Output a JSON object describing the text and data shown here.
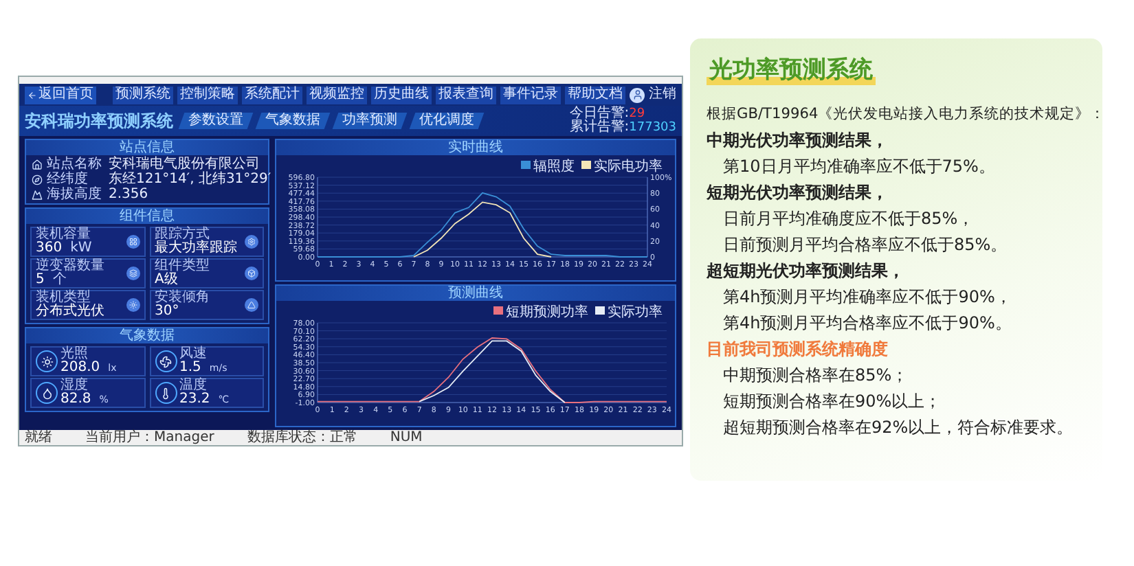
{
  "screenshot": {
    "nav": {
      "back": "返回首页",
      "items": [
        "预测系统",
        "控制策略",
        "系统配计",
        "视频监控",
        "历史曲线",
        "报表查询",
        "事件记录",
        "帮助文档"
      ],
      "user": "注销"
    },
    "header": {
      "title": "安科瑞功率预测系统",
      "tabs": [
        "参数设置",
        "气象数据",
        "功率预测",
        "优化调度"
      ],
      "alarms": [
        {
          "label": "今日告警:",
          "value": "29",
          "kind": "today"
        },
        {
          "label": "累计告警:",
          "value": "177303",
          "kind": "total"
        }
      ]
    },
    "site_panel": {
      "title": "站点信息",
      "rows": [
        {
          "label": "站点名称",
          "value": "安科瑞电气股份有限公司"
        },
        {
          "label": "经纬度",
          "value": "东经121°14′, 北纬31°29′"
        },
        {
          "label": "海拔高度",
          "value": "2.356"
        }
      ]
    },
    "component_panel": {
      "title": "组件信息",
      "cards": [
        {
          "label": "装机容量",
          "value": "360",
          "unit": "kW"
        },
        {
          "label": "跟踪方式",
          "value": "最大功率跟踪"
        },
        {
          "label": "逆变器数量",
          "value": "5",
          "unit": "个"
        },
        {
          "label": "组件类型",
          "value": "A级"
        },
        {
          "label": "装机类型",
          "value": "分布式光伏"
        },
        {
          "label": "安装倾角",
          "value": "30°"
        }
      ]
    },
    "weather_panel": {
      "title": "气象数据",
      "cards": [
        {
          "label": "光照",
          "value": "208.0",
          "unit": "lx"
        },
        {
          "label": "风速",
          "value": "1.5",
          "unit": "m/s"
        },
        {
          "label": "湿度",
          "value": "82.8",
          "unit": "%"
        },
        {
          "label": "温度",
          "value": "23.2",
          "unit": "℃"
        }
      ]
    },
    "charts": [
      {
        "title": "实时曲线",
        "chart_data": {
          "type": "line",
          "x": [
            0,
            1,
            2,
            3,
            4,
            5,
            6,
            7,
            8,
            9,
            10,
            11,
            12,
            13,
            14,
            15,
            16,
            17,
            18,
            19,
            20,
            21,
            22,
            23,
            24
          ],
          "xlim": [
            0,
            24
          ],
          "xticks": [
            0,
            1,
            2,
            3,
            4,
            5,
            6,
            7,
            8,
            9,
            10,
            11,
            12,
            13,
            14,
            15,
            16,
            17,
            18,
            19,
            20,
            21,
            22,
            23,
            24
          ],
          "ylim": [
            0,
            596.8
          ],
          "yticks": [
            {
              "value": 0,
              "label": "0.00"
            },
            {
              "value": 59.68,
              "label": "59.68"
            },
            {
              "value": 119.36,
              "label": "119.36"
            },
            {
              "value": 179.04,
              "label": "179.04"
            },
            {
              "value": 238.72,
              "label": "238.72"
            },
            {
              "value": 298.4,
              "label": "298.40"
            },
            {
              "value": 358.08,
              "label": "358.08"
            },
            {
              "value": 417.76,
              "label": "417.76"
            },
            {
              "value": 477.44,
              "label": "477.44"
            },
            {
              "value": 537.12,
              "label": "537.12"
            },
            {
              "value": 596.8,
              "label": "596.80"
            }
          ],
          "grid": true,
          "legend": "upper right",
          "y2lim": [
            0,
            100
          ],
          "y2ticks": [
            0,
            20,
            40,
            60,
            80,
            {
              "value": 100,
              "label": "100%"
            }
          ],
          "series": [
            {
              "name": "辐照度",
              "color": "#3a8fd6",
              "values": [
                0,
                0,
                0,
                0,
                0,
                0,
                0,
                10,
                110,
                200,
                330,
                370,
                480,
                450,
                380,
                210,
                80,
                20,
                10,
                10,
                10,
                10,
                0,
                0,
                0
              ]
            },
            {
              "name": "实际电功率",
              "color": "#f3e6b8",
              "values": [
                null,
                null,
                null,
                null,
                null,
                null,
                null,
                0,
                50,
                140,
                250,
                320,
                410,
                390,
                330,
                140,
                20,
                0,
                null,
                null,
                null,
                null,
                null,
                null,
                null
              ]
            }
          ]
        }
      },
      {
        "title": "预测曲线",
        "chart_data": {
          "type": "line",
          "x": [
            0,
            1,
            2,
            3,
            4,
            5,
            6,
            7,
            8,
            9,
            10,
            11,
            12,
            13,
            14,
            15,
            16,
            17,
            18,
            19,
            20,
            21,
            22,
            23,
            24
          ],
          "xlim": [
            0,
            24
          ],
          "xticks": [
            0,
            1,
            2,
            3,
            4,
            5,
            6,
            7,
            8,
            9,
            10,
            11,
            12,
            13,
            14,
            15,
            16,
            17,
            18,
            19,
            20,
            21,
            22,
            23,
            24
          ],
          "ylim": [
            -1,
            78
          ],
          "yticks": [
            {
              "value": -1,
              "label": "-1.00"
            },
            {
              "value": 6.9,
              "label": "6.90"
            },
            {
              "value": 14.8,
              "label": "14.80"
            },
            {
              "value": 22.7,
              "label": "22.70"
            },
            {
              "value": 30.6,
              "label": "30.60"
            },
            {
              "value": 38.5,
              "label": "38.50"
            },
            {
              "value": 46.4,
              "label": "46.40"
            },
            {
              "value": 54.3,
              "label": "54.30"
            },
            {
              "value": 62.2,
              "label": "62.20"
            },
            {
              "value": 70.1,
              "label": "70.10"
            },
            {
              "value": 78,
              "label": "78.00"
            }
          ],
          "grid": true,
          "legend": "upper right",
          "series": [
            {
              "name": "短期预测功率",
              "color": "#e8707e",
              "values": [
                0,
                0,
                0,
                0,
                0,
                0,
                0,
                0,
                10,
                24,
                42,
                54,
                63,
                62,
                52,
                30,
                12,
                -1,
                -1,
                0,
                0,
                0,
                0,
                0,
                0
              ]
            },
            {
              "name": "实际功率",
              "color": "#e6ecf5",
              "values": [
                null,
                null,
                null,
                null,
                null,
                null,
                null,
                0,
                6,
                14,
                30,
                45,
                60,
                60,
                50,
                26,
                10,
                -1,
                null,
                null,
                null,
                null,
                null,
                null,
                null
              ]
            }
          ]
        }
      }
    ],
    "status_bar": [
      "就绪",
      "当前用户：Manager",
      "数据库状态：正常",
      "NUM"
    ]
  },
  "info_card": {
    "title": "光功率预测系统",
    "lines": [
      {
        "kind": "intro",
        "text": "根据GB/T19964《光伏发电站接入电力系统的技术规定》："
      },
      {
        "kind": "heading",
        "text": "中期光伏功率预测结果，"
      },
      {
        "kind": "item",
        "text": "第10日月平均准确率应不低于75%。"
      },
      {
        "kind": "heading",
        "text": "短期光伏功率预测结果，"
      },
      {
        "kind": "item",
        "text": "日前月平均准确度应不低于85%，"
      },
      {
        "kind": "item",
        "text": "日前预测月平均合格率应不低于85%。"
      },
      {
        "kind": "heading",
        "text": "超短期光伏功率预测结果，"
      },
      {
        "kind": "item",
        "text": "第4h预测月平均准确率应不低于90%，"
      },
      {
        "kind": "item",
        "text": "第4h预测月平均合格率应不低于90%。"
      },
      {
        "kind": "highlight",
        "text": "目前我司预测系统精确度"
      },
      {
        "kind": "item",
        "text": "中期预测合格率在85%；"
      },
      {
        "kind": "item",
        "text": "短期预测合格率在90%以上；"
      },
      {
        "kind": "item",
        "text": "超短期预测合格率在92%以上，符合标准要求。"
      }
    ]
  }
}
